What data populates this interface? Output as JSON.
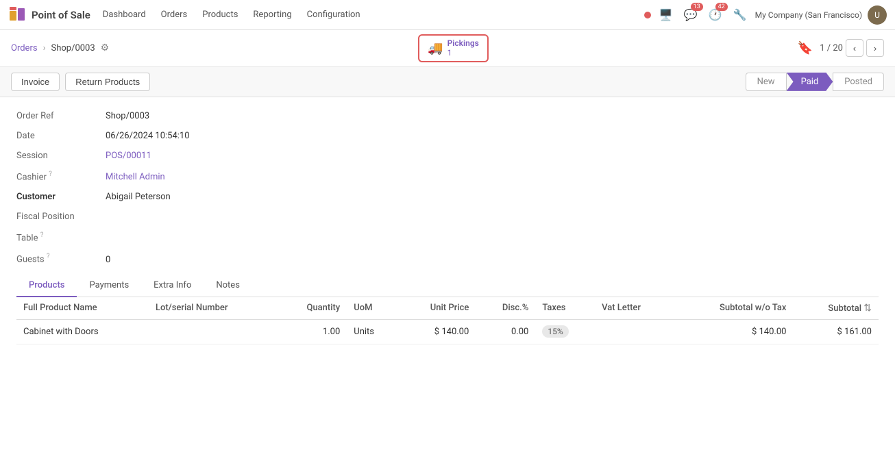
{
  "app": {
    "name": "Point of Sale"
  },
  "nav": {
    "logo_text": "Point of Sale",
    "menu_items": [
      "Dashboard",
      "Orders",
      "Products",
      "Reporting",
      "Configuration"
    ],
    "company": "My Company (San Francisco)",
    "badges": {
      "chat": "13",
      "activity": "42"
    }
  },
  "breadcrumb": {
    "parent": "Orders",
    "current": "Shop/0003",
    "settings_icon": "⚙"
  },
  "pickings": {
    "label": "Pickings",
    "count": "1"
  },
  "pagination": {
    "current": "1",
    "total": "20"
  },
  "toolbar": {
    "invoice_label": "Invoice",
    "return_products_label": "Return Products",
    "status_new": "New",
    "status_paid": "Paid",
    "status_posted": "Posted"
  },
  "form": {
    "order_ref_label": "Order Ref",
    "order_ref_value": "Shop/0003",
    "date_label": "Date",
    "date_value": "06/26/2024 10:54:10",
    "session_label": "Session",
    "session_value": "POS/00011",
    "cashier_label": "Cashier",
    "cashier_value": "Mitchell Admin",
    "customer_label": "Customer",
    "customer_value": "Abigail Peterson",
    "fiscal_label": "Fiscal Position",
    "fiscal_value": "",
    "table_label": "Table",
    "table_value": "",
    "guests_label": "Guests",
    "guests_value": "0"
  },
  "tabs": [
    "Products",
    "Payments",
    "Extra Info",
    "Notes"
  ],
  "table_headers": [
    "Full Product Name",
    "Lot/serial Number",
    "Quantity",
    "UoM",
    "Unit Price",
    "Disc.%",
    "Taxes",
    "Vat Letter",
    "Subtotal w/o Tax",
    "Subtotal"
  ],
  "table_rows": [
    {
      "product_name": "Cabinet with Doors",
      "lot_serial": "",
      "quantity": "1.00",
      "uom": "Units",
      "unit_price": "$ 140.00",
      "disc": "0.00",
      "taxes": "15%",
      "vat_letter": "",
      "subtotal_wo_tax": "$ 140.00",
      "subtotal": "$ 161.00"
    }
  ]
}
